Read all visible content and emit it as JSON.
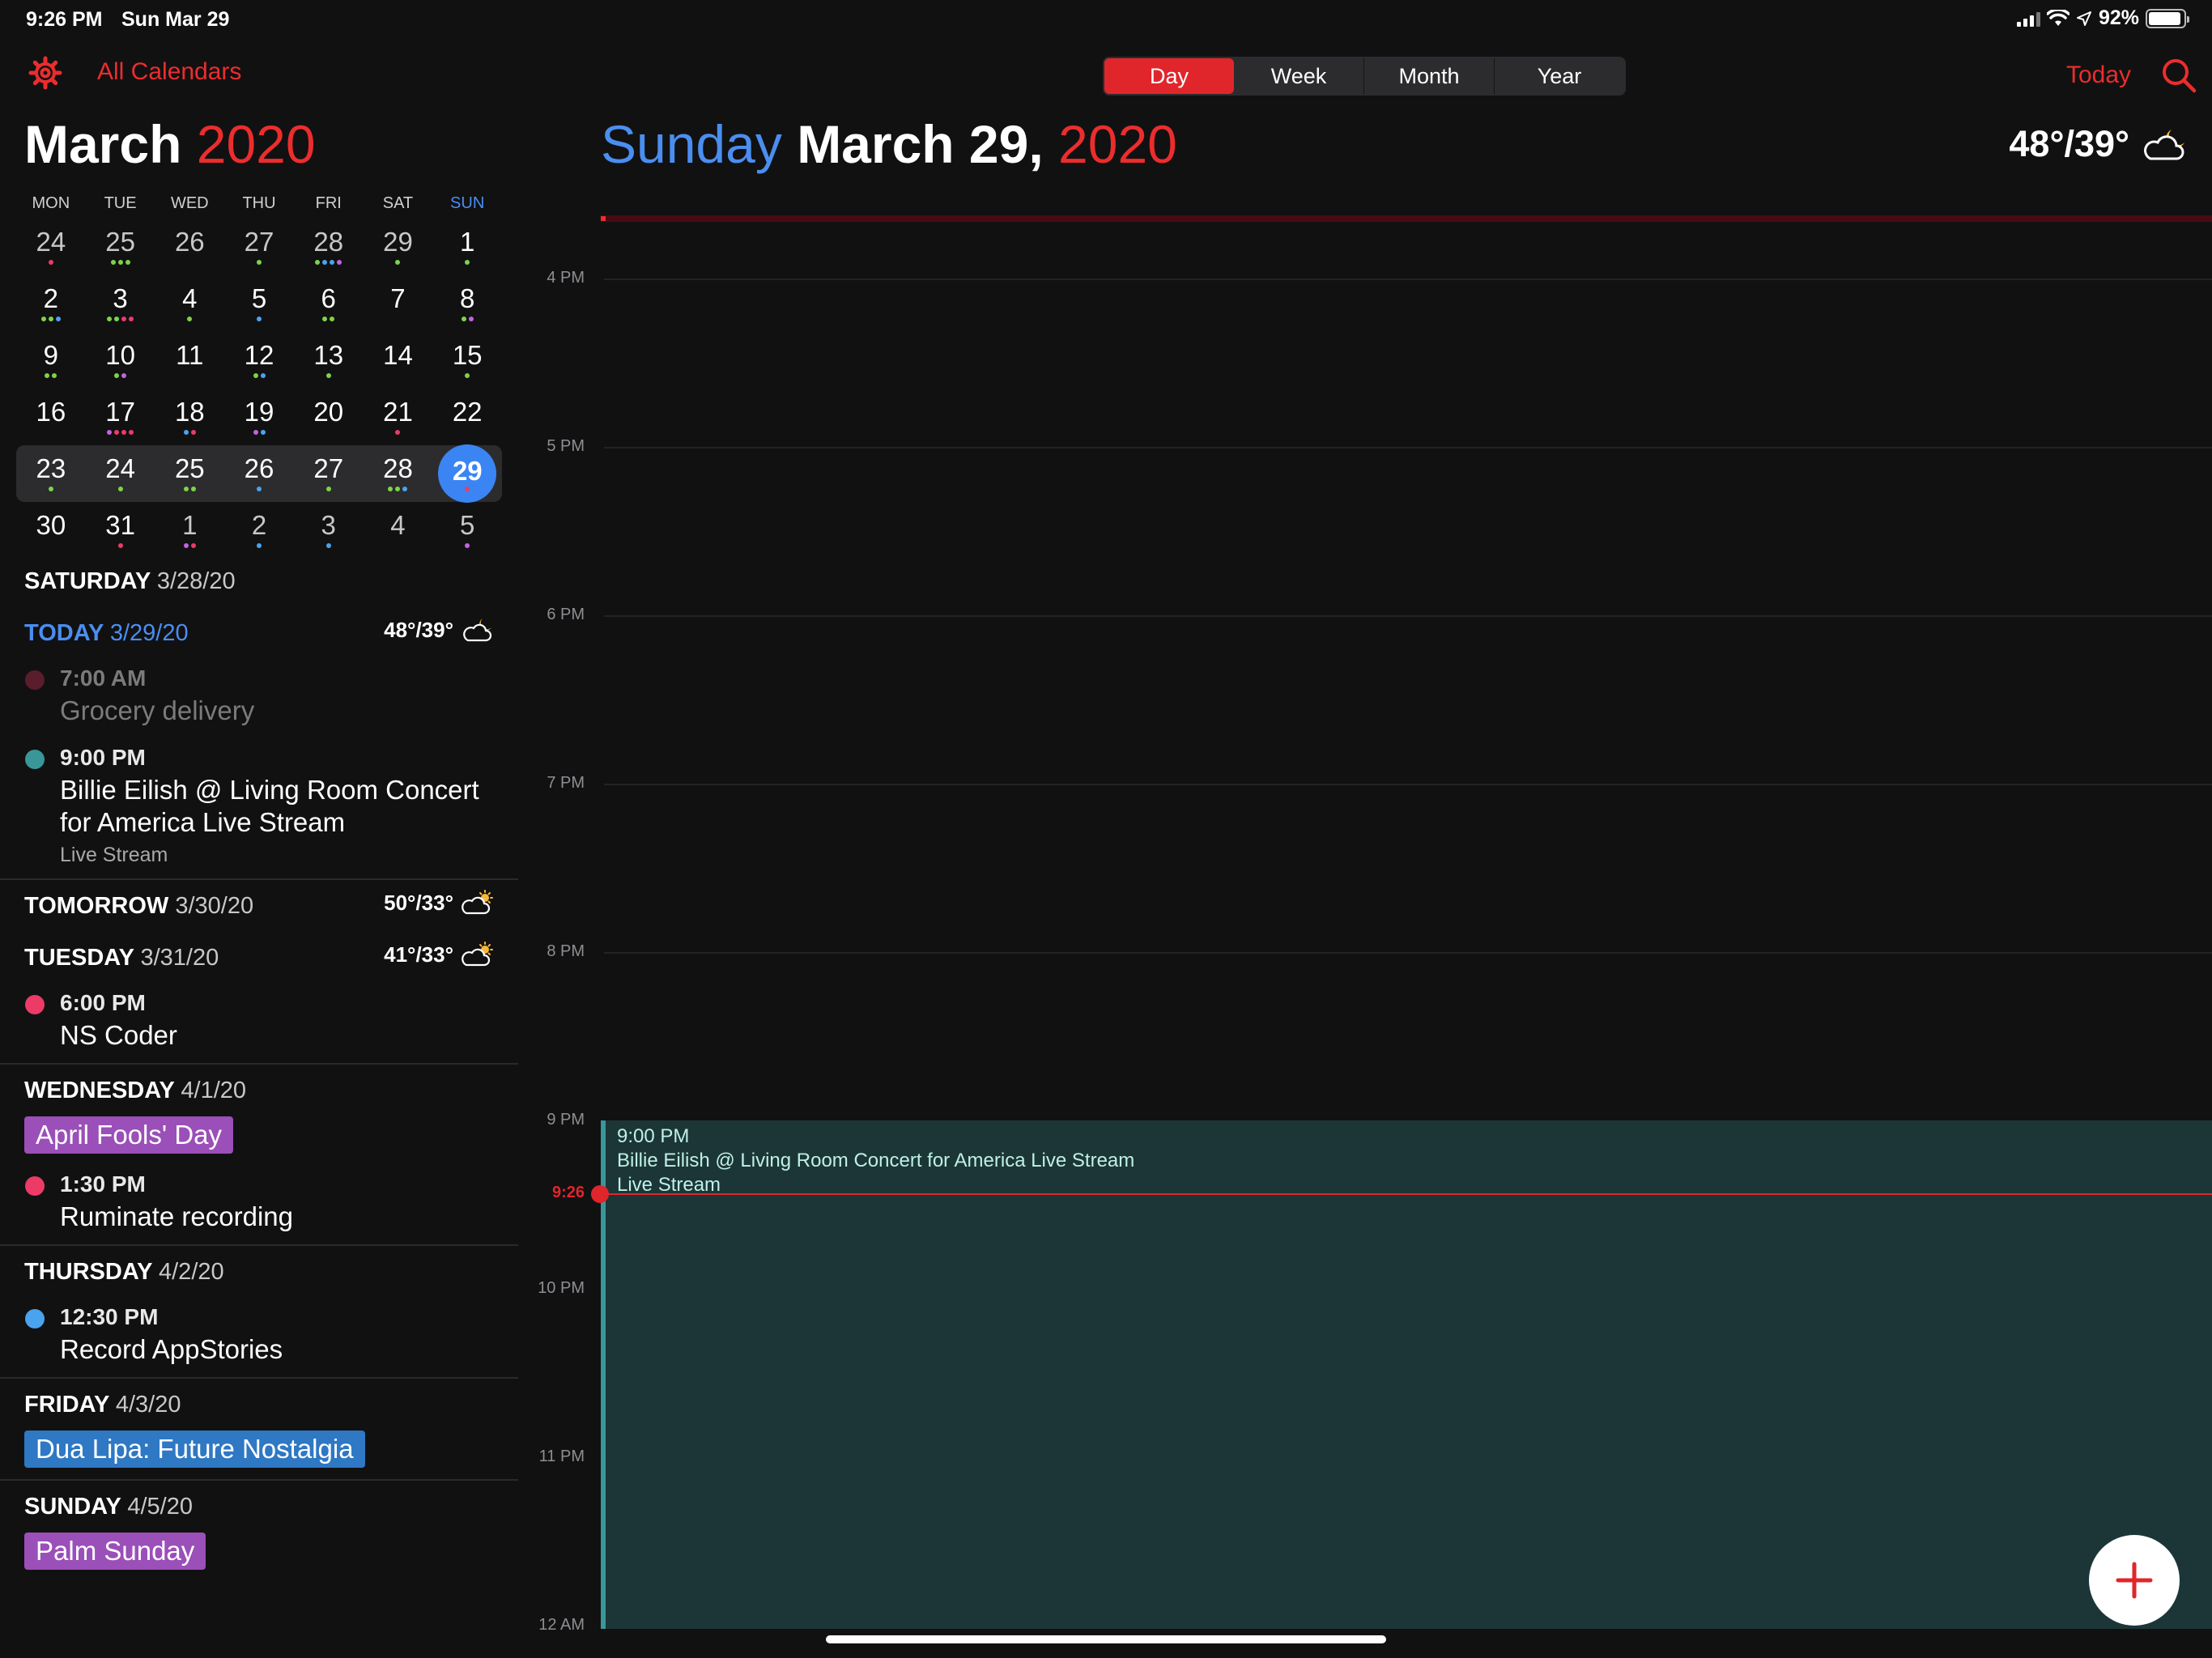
{
  "status_bar": {
    "time": "9:26 PM",
    "date": "Sun Mar 29",
    "battery": "92%",
    "battery_level": 0.92
  },
  "toolbar": {
    "calendars_label": "All Calendars",
    "view_tabs": [
      {
        "label": "Day",
        "active": true
      },
      {
        "label": "Week",
        "active": false
      },
      {
        "label": "Month",
        "active": false
      },
      {
        "label": "Year",
        "active": false
      }
    ],
    "today_label": "Today",
    "accent": "#ec2d2d"
  },
  "mini_calendar": {
    "month": "March",
    "year": "2020",
    "weekdays": [
      "MON",
      "TUE",
      "WED",
      "THU",
      "FRI",
      "SAT",
      "SUN"
    ],
    "weeks": [
      [
        {
          "d": "24",
          "o": true,
          "dots": [
            "#ec3b67"
          ]
        },
        {
          "d": "25",
          "o": true,
          "dots": [
            "#7ed348",
            "#7ed348",
            "#7ed348"
          ]
        },
        {
          "d": "26",
          "o": true,
          "dots": []
        },
        {
          "d": "27",
          "o": true,
          "dots": [
            "#7ed348"
          ]
        },
        {
          "d": "28",
          "o": true,
          "dots": [
            "#7ed348",
            "#4aa3ee",
            "#4aa3ee",
            "#c263e0"
          ]
        },
        {
          "d": "29",
          "o": true,
          "dots": [
            "#7ed348"
          ]
        },
        {
          "d": "1",
          "dots": [
            "#7ed348"
          ]
        }
      ],
      [
        {
          "d": "2",
          "dots": [
            "#7ed348",
            "#7ed348",
            "#4aa3ee"
          ]
        },
        {
          "d": "3",
          "dots": [
            "#7ed348",
            "#7ed348",
            "#ec3b67",
            "#ec3b67"
          ]
        },
        {
          "d": "4",
          "dots": [
            "#7ed348"
          ]
        },
        {
          "d": "5",
          "dots": [
            "#4aa3ee"
          ]
        },
        {
          "d": "6",
          "dots": [
            "#7ed348",
            "#7ed348"
          ]
        },
        {
          "d": "7",
          "dots": []
        },
        {
          "d": "8",
          "dots": [
            "#7ed348",
            "#c263e0"
          ]
        }
      ],
      [
        {
          "d": "9",
          "dots": [
            "#7ed348",
            "#7ed348"
          ]
        },
        {
          "d": "10",
          "dots": [
            "#7ed348",
            "#c263e0"
          ]
        },
        {
          "d": "11",
          "dots": []
        },
        {
          "d": "12",
          "dots": [
            "#7ed348",
            "#4aa3ee"
          ]
        },
        {
          "d": "13",
          "dots": [
            "#7ed348"
          ]
        },
        {
          "d": "14",
          "dots": []
        },
        {
          "d": "15",
          "dots": [
            "#7ed348"
          ]
        }
      ],
      [
        {
          "d": "16",
          "dots": []
        },
        {
          "d": "17",
          "dots": [
            "#c263e0",
            "#ec3b67",
            "#ec3b67",
            "#ec3b67"
          ]
        },
        {
          "d": "18",
          "dots": [
            "#4aa3ee",
            "#ec3b67"
          ]
        },
        {
          "d": "19",
          "dots": [
            "#c263e0",
            "#4aa3ee"
          ]
        },
        {
          "d": "20",
          "dots": []
        },
        {
          "d": "21",
          "dots": [
            "#ec3b67"
          ]
        },
        {
          "d": "22",
          "dots": []
        }
      ],
      [
        {
          "d": "23",
          "dots": [
            "#7ed348"
          ]
        },
        {
          "d": "24",
          "dots": [
            "#7ed348"
          ]
        },
        {
          "d": "25",
          "dots": [
            "#7ed348",
            "#7ed348"
          ]
        },
        {
          "d": "26",
          "dots": [
            "#4aa3ee"
          ]
        },
        {
          "d": "27",
          "dots": [
            "#7ed348"
          ]
        },
        {
          "d": "28",
          "dots": [
            "#7ed348",
            "#7ed348",
            "#4aa3ee"
          ]
        },
        {
          "d": "29",
          "sel": true,
          "dots": [
            "#ec3b67"
          ]
        }
      ],
      [
        {
          "d": "30",
          "dots": []
        },
        {
          "d": "31",
          "dots": [
            "#ec3b67"
          ]
        },
        {
          "d": "1",
          "o": true,
          "dots": [
            "#c263e0",
            "#ec3b67"
          ]
        },
        {
          "d": "2",
          "o": true,
          "dots": [
            "#4aa3ee"
          ]
        },
        {
          "d": "3",
          "o": true,
          "dots": [
            "#4aa3ee"
          ]
        },
        {
          "d": "4",
          "o": true,
          "dots": []
        },
        {
          "d": "5",
          "o": true,
          "dots": [
            "#c263e0"
          ]
        }
      ]
    ],
    "current_week_index": 4
  },
  "agenda": [
    {
      "day": "SATURDAY",
      "date": "3/28/20",
      "events": []
    },
    {
      "day": "TODAY",
      "date": "3/29/20",
      "today": true,
      "weather": {
        "temp": "48°/39°",
        "icon": "cloud-moon-icon"
      },
      "events": [
        {
          "time": "7:00 AM",
          "title": "Grocery delivery",
          "color": "#5a1d2b",
          "past": true
        },
        {
          "time": "9:00 PM",
          "title": "Billie Eilish @ Living Room Concert for America Live Stream",
          "sub": "Live Stream",
          "color": "#3a9799"
        }
      ]
    },
    {
      "day": "TOMORROW",
      "date": "3/30/20",
      "weather": {
        "temp": "50°/33°",
        "icon": "cloud-sun-icon"
      },
      "events": []
    },
    {
      "day": "TUESDAY",
      "date": "3/31/20",
      "weather": {
        "temp": "41°/33°",
        "icon": "cloud-sun-icon"
      },
      "events": [
        {
          "time": "6:00 PM",
          "title": "NS Coder",
          "color": "#ec3b67"
        }
      ]
    },
    {
      "day": "WEDNESDAY",
      "date": "4/1/20",
      "allday": [
        {
          "title": "April Fools' Day",
          "color": "#9b4fb8"
        }
      ],
      "events": [
        {
          "time": "1:30 PM",
          "title": "Ruminate recording",
          "color": "#ec3b67"
        }
      ]
    },
    {
      "day": "THURSDAY",
      "date": "4/2/20",
      "events": [
        {
          "time": "12:30 PM",
          "title": "Record AppStories",
          "color": "#4aa3ee"
        }
      ]
    },
    {
      "day": "FRIDAY",
      "date": "4/3/20",
      "allday": [
        {
          "title": "Dua Lipa: Future Nostalgia",
          "color": "#2e78c4"
        }
      ],
      "events": []
    },
    {
      "day": "SUNDAY",
      "date": "4/5/20",
      "allday": [
        {
          "title": "Palm Sunday",
          "color": "#9b4fb8"
        }
      ],
      "events": []
    }
  ],
  "day_view": {
    "weekday": "Sunday",
    "month_day": "March 29,",
    "year": "2020",
    "weather": {
      "temp": "48°/39°",
      "icon": "cloud-moon-icon"
    },
    "hours": [
      "4 PM",
      "5 PM",
      "6 PM",
      "7 PM",
      "8 PM",
      "9 PM",
      "10 PM",
      "11 PM",
      "12 AM"
    ],
    "now_label": "9:26",
    "event": {
      "time": "9:00 PM",
      "title": "Billie Eilish @ Living Room Concert for America Live Stream",
      "sub": "Live Stream",
      "color": "#3a9799"
    }
  }
}
